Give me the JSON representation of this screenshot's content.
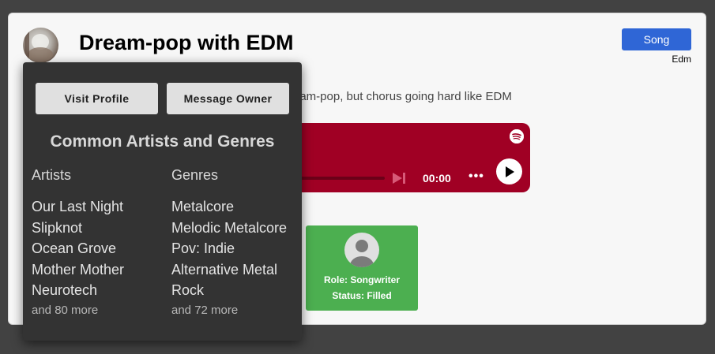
{
  "post": {
    "title": "Dream-pop with EDM",
    "type_button": "Song",
    "genre_tag": "Edm",
    "description_visible": "eam-pop, but chorus going hard like EDM"
  },
  "player": {
    "time": "00:00",
    "icons": [
      "spotify-icon",
      "skip-forward-icon",
      "more-icon",
      "play-icon"
    ],
    "accent": "#a00024"
  },
  "role_card": {
    "role": "Role: Songwriter",
    "status": "Status: Filled",
    "color": "#4caf50"
  },
  "popup": {
    "visit_label": "Visit Profile",
    "message_label": "Message Owner",
    "title": "Common Artists and Genres",
    "artists_header": "Artists",
    "genres_header": "Genres",
    "artists": [
      "Our Last Night",
      "Slipknot",
      "Ocean Grove",
      "Mother Mother",
      "Neurotech"
    ],
    "artists_more": "and 80 more",
    "genres": [
      "Metalcore",
      "Melodic Metalcore",
      "Pov: Indie",
      "Alternative Metal",
      "Rock"
    ],
    "genres_more": "and 72 more"
  }
}
